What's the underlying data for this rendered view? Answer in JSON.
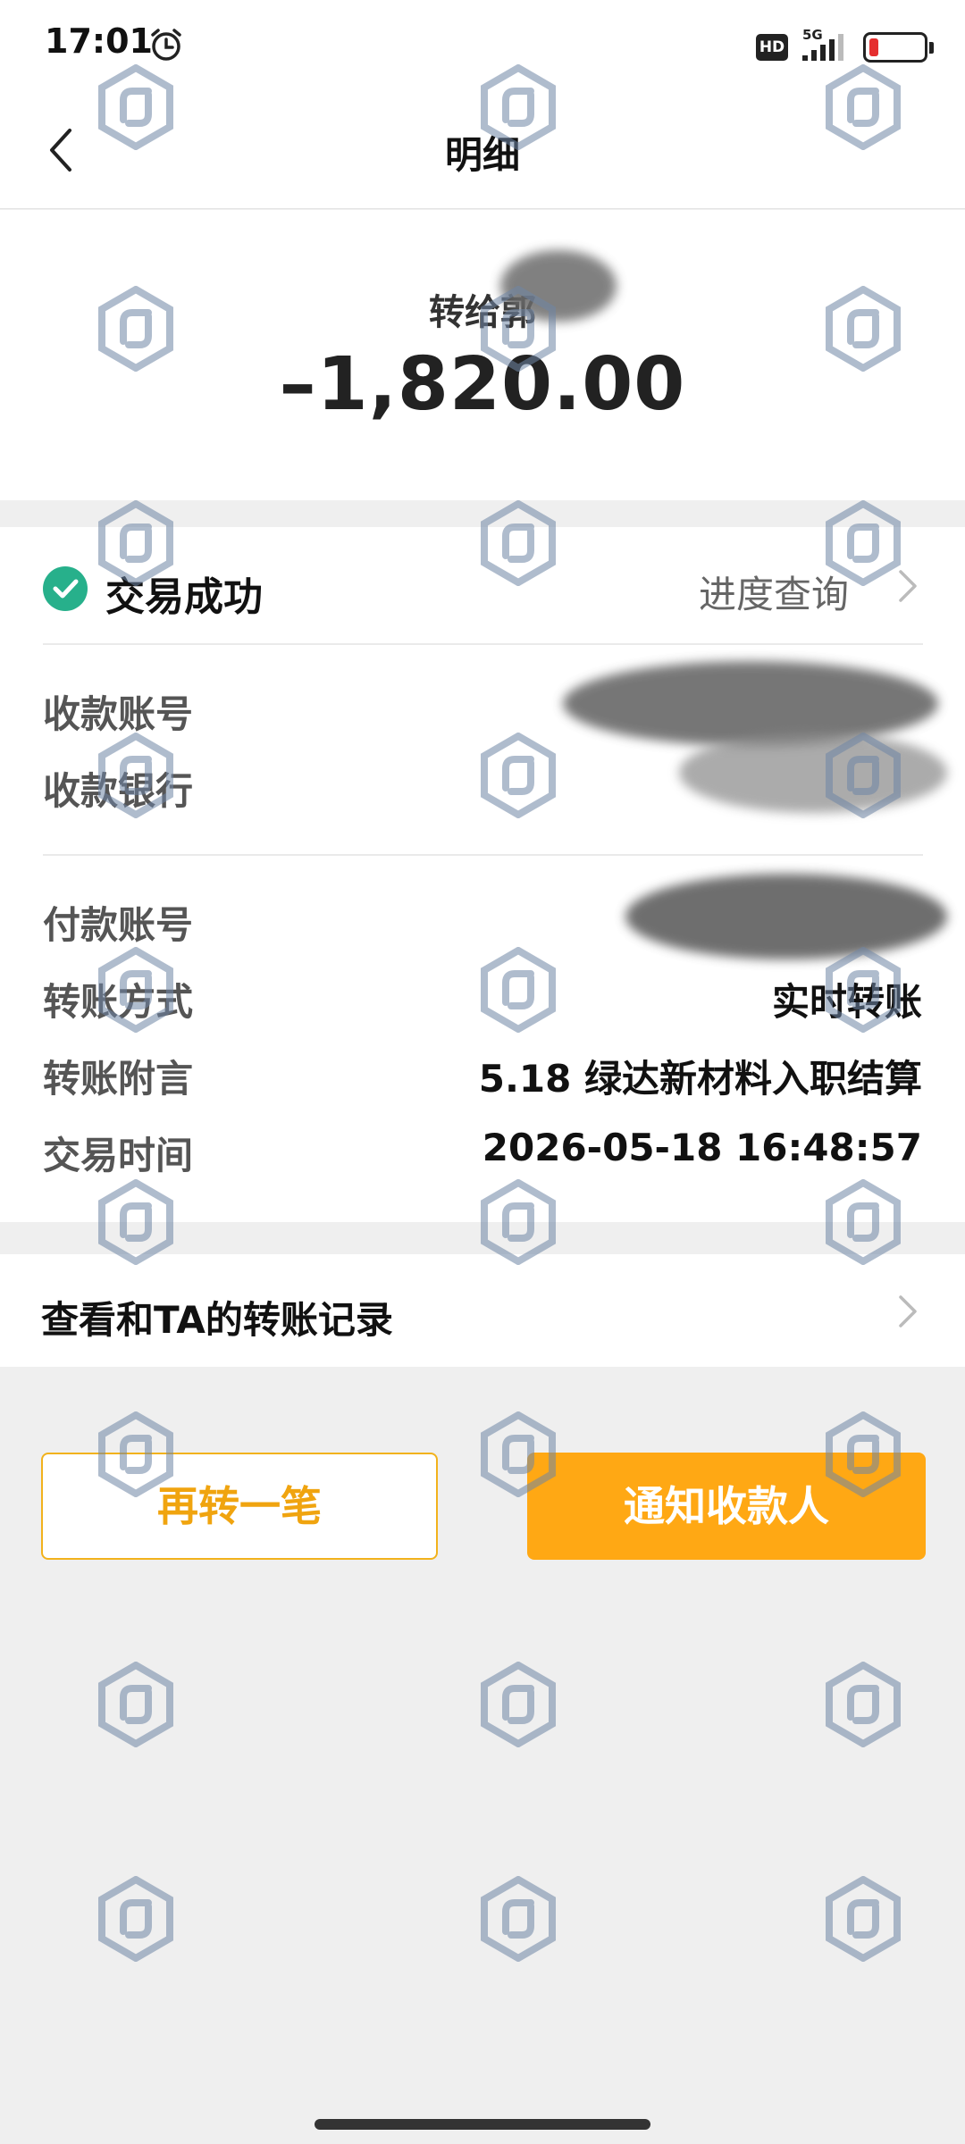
{
  "status_bar": {
    "time": "17:01",
    "hd_badge": "HD",
    "network": "5G",
    "battery_level": 0.15
  },
  "nav": {
    "title": "明细"
  },
  "summary": {
    "recipient": "转给郭",
    "amount": "–1,820.00"
  },
  "transaction": {
    "status": "交易成功",
    "progress_link": "进度查询"
  },
  "details": {
    "payee_account_label": "收款账号",
    "payee_bank_label": "收款银行",
    "payer_account_label": "付款账号",
    "method_label": "转账方式",
    "method_value": "实时转账",
    "memo_label": "转账附言",
    "memo_value": "5.18 绿达新材料入职结算",
    "time_label": "交易时间",
    "time_value": "2026-05-18 16:48:57"
  },
  "records": {
    "label": "查看和TA的转账记录"
  },
  "actions": {
    "again_label": "再转一笔",
    "notify_label": "通知收款人"
  },
  "colors": {
    "accent": "#ffa814",
    "success": "#27b08b",
    "battery_low": "#e52e2e"
  },
  "icons": [
    "alarm-icon",
    "signal-icon",
    "battery-icon",
    "back-arrow-icon",
    "check-circle-icon",
    "chevron-right-icon",
    "watermark-logo-icon"
  ]
}
